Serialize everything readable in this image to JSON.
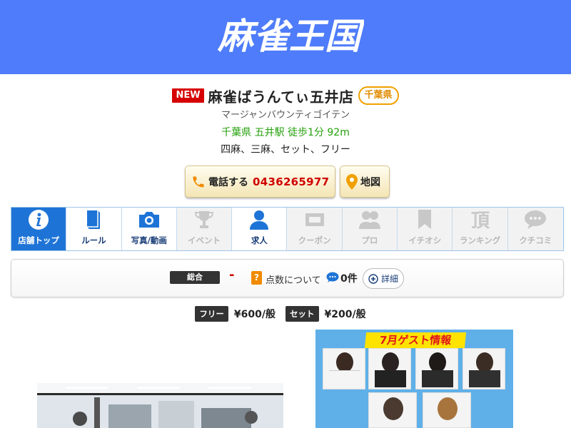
{
  "header": {
    "logo_text": "麻雀王国",
    "bg_color": "#4e7cfa"
  },
  "shop": {
    "new_badge": "NEW",
    "name": "麻雀ばうんてぃ五井店",
    "prefecture": "千葉県",
    "kana": "マージャンバウンティゴイテン",
    "access": "千葉県 五井駅 徒歩1分 92m",
    "games": "四麻、三麻、セット、フリー"
  },
  "actions": {
    "tel_label": "電話する",
    "tel_number": "0436265977",
    "map_label": "地図"
  },
  "tabs": [
    {
      "label": "店舗トップ",
      "icon": "info-icon",
      "state": "active"
    },
    {
      "label": "ルール",
      "icon": "book-icon",
      "state": "on"
    },
    {
      "label": "写真/動画",
      "icon": "camera-icon",
      "state": "on"
    },
    {
      "label": "イベント",
      "icon": "trophy-icon",
      "state": "off"
    },
    {
      "label": "求人",
      "icon": "person-icon",
      "state": "on"
    },
    {
      "label": "クーポン",
      "icon": "coupon-icon",
      "state": "off"
    },
    {
      "label": "プロ",
      "icon": "pros-icon",
      "state": "off"
    },
    {
      "label": "イチオシ",
      "icon": "bookmark-icon",
      "state": "off"
    },
    {
      "label": "ランキング",
      "icon": "ranking-icon",
      "state": "off"
    },
    {
      "label": "クチコミ",
      "icon": "speech-bubble-icon",
      "state": "off"
    }
  ],
  "score": {
    "overall_label": "総合",
    "overall_value": "-",
    "help_icon": "?",
    "about_label": "点数について",
    "comment_count": "0件",
    "detail_label": "詳細"
  },
  "prices": [
    {
      "tag": "フリー",
      "value": "¥600/般"
    },
    {
      "tag": "セット",
      "value": "¥200/般"
    }
  ],
  "flyer": {
    "title": "7月ゲスト情報"
  },
  "colors": {
    "accent_blue": "#1e74d6",
    "tel_red": "#d00000",
    "access_green": "#23a00a",
    "pref_orange": "#f0a000"
  }
}
